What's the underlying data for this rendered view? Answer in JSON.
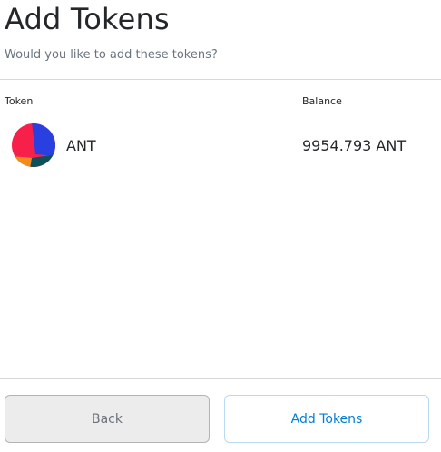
{
  "header": {
    "title": "Add Tokens",
    "subtitle": "Would you like to add these tokens?"
  },
  "table": {
    "headers": {
      "token": "Token",
      "balance": "Balance"
    },
    "rows": [
      {
        "symbol": "ANT",
        "balance": "9954.793 ANT",
        "icon": "token-identicon"
      }
    ]
  },
  "footer": {
    "back_label": "Back",
    "add_label": "Add Tokens"
  },
  "colors": {
    "primary": "#037dd6",
    "text": "#24272a",
    "muted": "#6a737d",
    "divider": "#d6d9dc"
  }
}
